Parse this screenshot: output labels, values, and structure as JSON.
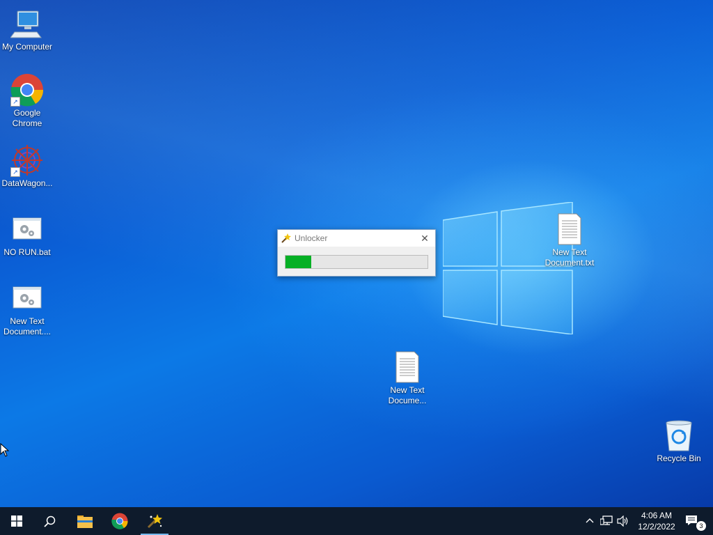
{
  "desktop": {
    "icons": [
      {
        "label": "My Computer",
        "icon": "computer-icon"
      },
      {
        "label": "Google\nChrome",
        "icon": "chrome-icon",
        "shortcut": true
      },
      {
        "label": "DataWagon...",
        "icon": "datawagon-icon",
        "shortcut": true
      },
      {
        "label": "NO RUN.bat",
        "icon": "batch-file-icon"
      },
      {
        "label": "New Text\nDocument....",
        "icon": "batch-file-icon"
      },
      {
        "label": "New Text\nDocume...",
        "icon": "text-document-icon"
      },
      {
        "label": "New Text\nDocument.txt",
        "icon": "text-document-icon"
      },
      {
        "label": "Recycle Bin",
        "icon": "recycle-bin-icon"
      }
    ]
  },
  "dialog": {
    "title": "Unlocker",
    "progress_fraction": 0.18,
    "progress_color": "#06b025"
  },
  "taskbar": {
    "apps": [
      "start-icon",
      "search-icon",
      "file-explorer-icon",
      "chrome-icon",
      "unlocker-icon"
    ],
    "clock_time": "4:06 AM",
    "clock_date": "12/2/2022",
    "notification_count": "3"
  }
}
